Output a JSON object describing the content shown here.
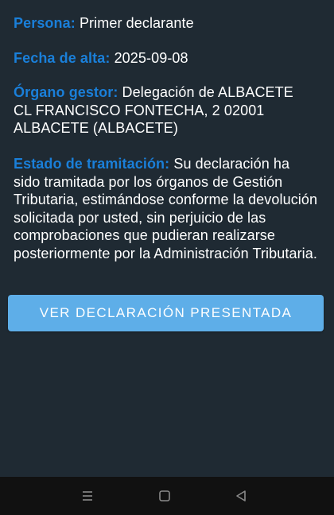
{
  "details": {
    "persona": {
      "label": "Persona:",
      "value": "Primer declarante"
    },
    "fecha_alta": {
      "label": "Fecha de alta:",
      "value": "2025-09-08"
    },
    "organo_gestor": {
      "label": "Órgano gestor:",
      "value": "Delegación de ALBACETE CL FRANCISCO FONTECHA, 2 02001 ALBACETE (ALBACETE)"
    },
    "estado_tramitacion": {
      "label": "Estado de tramitación:",
      "value": "Su declaración ha sido tramitada por los órganos de Gestión Tributaria, estimándose conforme la devolución solicitada por usted, sin perjuicio de las comprobaciones que pudieran realizarse posteriormente por la Administración Tributaria."
    }
  },
  "actions": {
    "ver_declaracion_label": "VER DECLARACIÓN PRESENTADA"
  },
  "navigation_bar": {
    "icons": [
      "menu-lines-icon",
      "home-square-icon",
      "back-triangle-icon"
    ]
  },
  "colors": {
    "background": "#1f2a33",
    "label_blue": "#1a7fd9",
    "button": "#5eaee8",
    "nav_bar": "#111111"
  }
}
